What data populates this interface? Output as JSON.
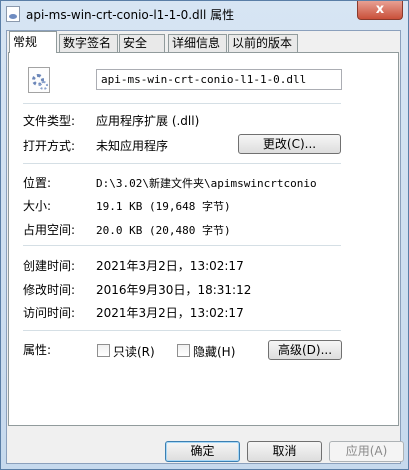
{
  "window": {
    "title": "api-ms-win-crt-conio-l1-1-0.dll 属性",
    "close_glyph": "x"
  },
  "tabs": [
    {
      "label": "常规",
      "active": true
    },
    {
      "label": "数字签名",
      "active": false
    },
    {
      "label": "安全",
      "active": false
    },
    {
      "label": "详细信息",
      "active": false
    },
    {
      "label": "以前的版本",
      "active": false
    }
  ],
  "general": {
    "file_name": "api-ms-win-crt-conio-l1-1-0.dll",
    "file_type_label": "文件类型:",
    "file_type_value": "应用程序扩展 (.dll)",
    "opens_with_label": "打开方式:",
    "opens_with_value": "未知应用程序",
    "change_button": "更改(C)...",
    "location_label": "位置:",
    "location_value": "D:\\3.02\\新建文件夹\\apimswincrtconio",
    "size_label": "大小:",
    "size_value": "19.1 KB (19,648 字节)",
    "size_on_disk_label": "占用空间:",
    "size_on_disk_value": "20.0 KB (20,480 字节)",
    "created_label": "创建时间:",
    "created_value": "2021年3月2日，13:02:17",
    "modified_label": "修改时间:",
    "modified_value": "2016年9月30日，18:31:12",
    "accessed_label": "访问时间:",
    "accessed_value": "2021年3月2日，13:02:17",
    "attributes_label": "属性:",
    "readonly_label": "只读(R)",
    "readonly_checked": false,
    "hidden_label": "隐藏(H)",
    "hidden_checked": false,
    "advanced_button": "高级(D)..."
  },
  "footer": {
    "ok_button": "确定",
    "cancel_button": "取消",
    "apply_button": "应用(A)"
  }
}
